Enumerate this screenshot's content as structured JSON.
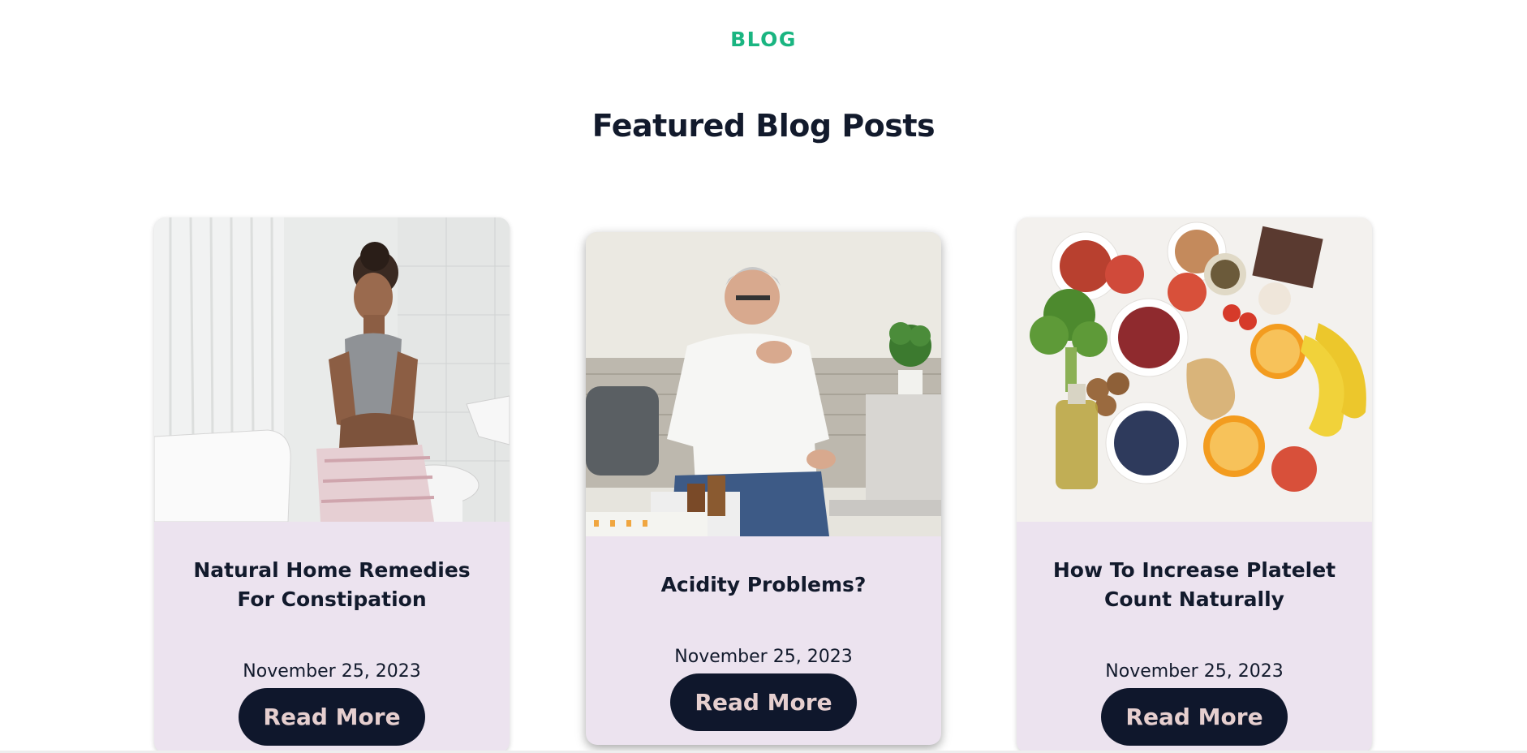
{
  "section": {
    "eyebrow": "BLOG",
    "heading": "Featured Blog Posts",
    "accent_color": "#1ab581",
    "heading_color": "#121a2c"
  },
  "posts": [
    {
      "title": "Natural Home Remedies For Constipation",
      "date": "November 25, 2023",
      "button_label": "Read More",
      "image_subject": "woman-with-stomach-ache-photo"
    },
    {
      "title": "Acidity Problems?",
      "date": "November 25, 2023",
      "button_label": "Read More",
      "image_subject": "man-with-heartburn-photo"
    },
    {
      "title": "How To Increase Platelet Count Naturally",
      "date": "November 25, 2023",
      "button_label": "Read More",
      "image_subject": "healthy-foods-photo"
    }
  ],
  "colors": {
    "card_background": "#ece3ef",
    "button_background": "#0f172c",
    "button_text": "#e6cfcf"
  }
}
